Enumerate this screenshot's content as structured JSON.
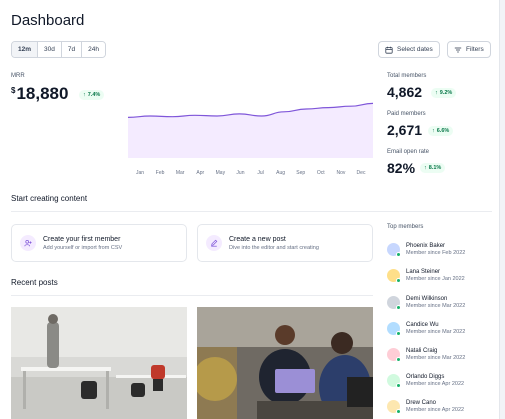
{
  "page": {
    "title": "Dashboard"
  },
  "time_ranges": [
    "12m",
    "30d",
    "7d",
    "24h"
  ],
  "toolbar": {
    "select_dates_label": "Select dates",
    "filters_label": "Filters"
  },
  "mrr": {
    "label": "MRR",
    "currency": "$",
    "value": "18,880",
    "change": "7.4%"
  },
  "chart_data": {
    "type": "area",
    "categories": [
      "Jan",
      "Feb",
      "Mar",
      "Apr",
      "May",
      "Jun",
      "Jul",
      "Aug",
      "Sep",
      "Oct",
      "Nov",
      "Dec"
    ],
    "series": [
      {
        "values": [
          0.58,
          0.6,
          0.59,
          0.61,
          0.6,
          0.63,
          0.6,
          0.66,
          0.7,
          0.72,
          0.74,
          0.78
        ]
      }
    ],
    "colors": {
      "line": "#7f56d9",
      "fill": "#f4ebff"
    }
  },
  "stats": [
    {
      "label": "Total members",
      "value": "4,862",
      "change": "9.2%"
    },
    {
      "label": "Paid members",
      "value": "2,671",
      "change": "6.6%"
    },
    {
      "label": "Email open rate",
      "value": "82%",
      "change": "8.1%"
    }
  ],
  "start_section": {
    "title": "Start creating content",
    "cards": [
      {
        "title": "Create your first member",
        "subtitle": "Add yourself or import from CSV",
        "icon": "user-plus-icon"
      },
      {
        "title": "Create a new post",
        "subtitle": "Dive into the editor and start creating",
        "icon": "pen-icon"
      }
    ]
  },
  "recent_posts": {
    "title": "Recent posts"
  },
  "top_members": {
    "title": "Top members",
    "items": [
      {
        "name": "Phoenix Baker",
        "since": "Member since Feb 2022",
        "color": "#c7d7fe"
      },
      {
        "name": "Lana Steiner",
        "since": "Member since Jan 2022",
        "color": "#fedf89"
      },
      {
        "name": "Demi Wilkinson",
        "since": "Member since Mar 2022",
        "color": "#d0d5dd"
      },
      {
        "name": "Candice Wu",
        "since": "Member since Mar 2022",
        "color": "#b2ddff"
      },
      {
        "name": "Natali Craig",
        "since": "Member since Mar 2022",
        "color": "#fecdd6"
      },
      {
        "name": "Orlando Diggs",
        "since": "Member since Apr 2022",
        "color": "#d1fadf"
      },
      {
        "name": "Drew Cano",
        "since": "Member since Apr 2022",
        "color": "#fde7b0"
      }
    ]
  }
}
